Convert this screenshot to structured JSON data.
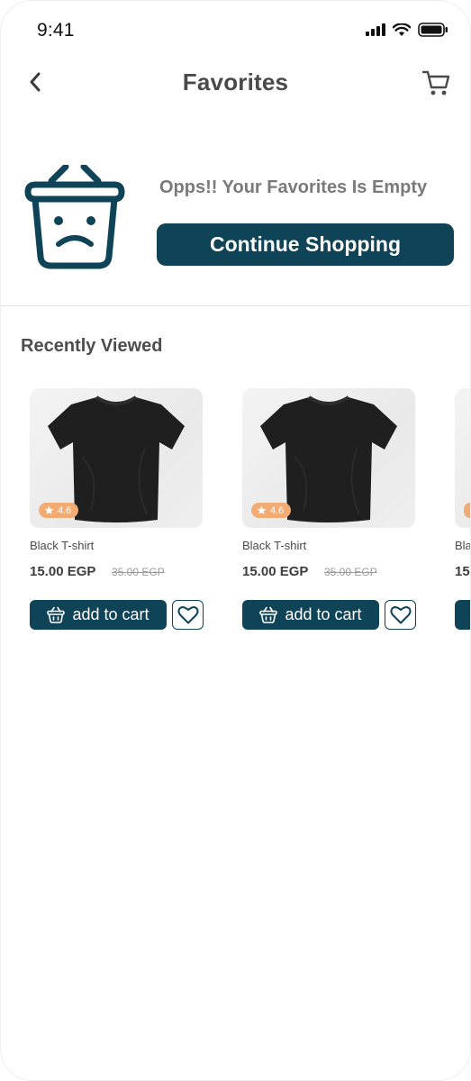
{
  "status_bar": {
    "time": "9:41"
  },
  "header": {
    "title": "Favorites"
  },
  "empty_state": {
    "message": "Opps!! Your Favorites Is Empty",
    "button_label": "Continue Shopping"
  },
  "recent": {
    "title": "Recently Viewed",
    "items": [
      {
        "name": "Black T-shirt",
        "price": "15.00 EGP",
        "old_price": "35.00 EGP",
        "rating": "4.6",
        "button_label": "add to cart"
      },
      {
        "name": "Black T-shirt",
        "price": "15.00 EGP",
        "old_price": "35.00 EGP",
        "rating": "4.6",
        "button_label": "add to cart"
      },
      {
        "name": "Bla",
        "price": "15",
        "old_price": "",
        "rating": "",
        "button_label": ""
      }
    ]
  },
  "colors": {
    "primary": "#0f4358",
    "rating_badge": "#f2ac73",
    "title_text": "#4a4a4a"
  },
  "icons": [
    "back-chevron-icon",
    "cart-icon",
    "sad-basket-icon",
    "star-icon",
    "basket-icon",
    "heart-icon",
    "signal-icon",
    "wifi-icon",
    "battery-icon"
  ]
}
